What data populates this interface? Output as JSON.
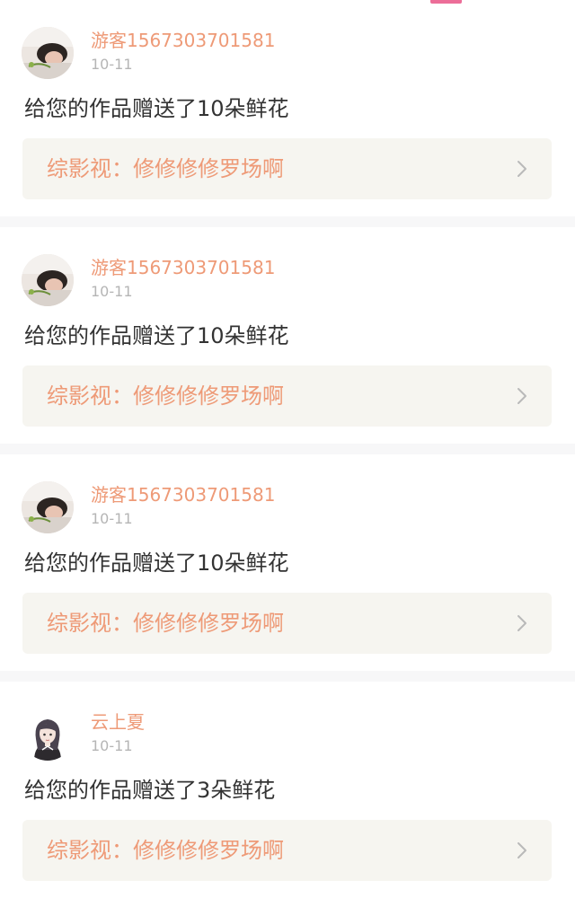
{
  "theme": {
    "accent": "#ee9a77",
    "tab_indicator": "#ec6d98",
    "link_background": "#f6f5f0",
    "date_color": "#b5b5b5"
  },
  "notifications": [
    {
      "avatar": "girl-lying-photo-avatar",
      "user": "游客1567303701581",
      "date": "10-11",
      "message": "给您的作品赠送了10朵鲜花",
      "work": "综影视：修修修修罗场啊",
      "chevron": "chevron-right-icon"
    },
    {
      "avatar": "girl-lying-photo-avatar",
      "user": "游客1567303701581",
      "date": "10-11",
      "message": "给您的作品赠送了10朵鲜花",
      "work": "综影视：修修修修罗场啊",
      "chevron": "chevron-right-icon"
    },
    {
      "avatar": "girl-lying-photo-avatar",
      "user": "游客1567303701581",
      "date": "10-11",
      "message": "给您的作品赠送了10朵鲜花",
      "work": "综影视：修修修修罗场啊",
      "chevron": "chevron-right-icon"
    },
    {
      "avatar": "anime-girl-avatar",
      "user": "云上夏",
      "date": "10-11",
      "message": "给您的作品赠送了3朵鲜花",
      "work": "综影视：修修修修罗场啊",
      "chevron": "chevron-right-icon"
    }
  ]
}
